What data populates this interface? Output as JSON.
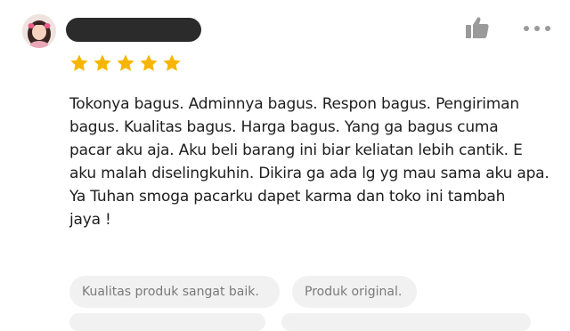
{
  "reviewer": {
    "name": ""
  },
  "rating": {
    "stars": 5,
    "max": 5,
    "star_color": "#f7b500"
  },
  "review": {
    "lines": [
      "Tokonya bagus. Adminnya bagus. Respon bagus. Pengiriman",
      "bagus. Kualitas bagus. Harga bagus. Yang ga bagus cuma",
      "pacar aku aja. Aku beli barang ini biar keliatan lebih cantik. E",
      "aku malah diselingkuhin. Dikira ga ada lg yg mau sama aku apa.",
      "Ya Tuhan smoga pacarku dapet karma dan toko ini tambah",
      "jaya !"
    ]
  },
  "tags": [
    {
      "label": "Kualitas produk sangat baik."
    },
    {
      "label": "Produk original."
    }
  ],
  "icons": {
    "like": "thumbs-up-icon",
    "more": "more-dots-icon",
    "star": "star-icon"
  }
}
